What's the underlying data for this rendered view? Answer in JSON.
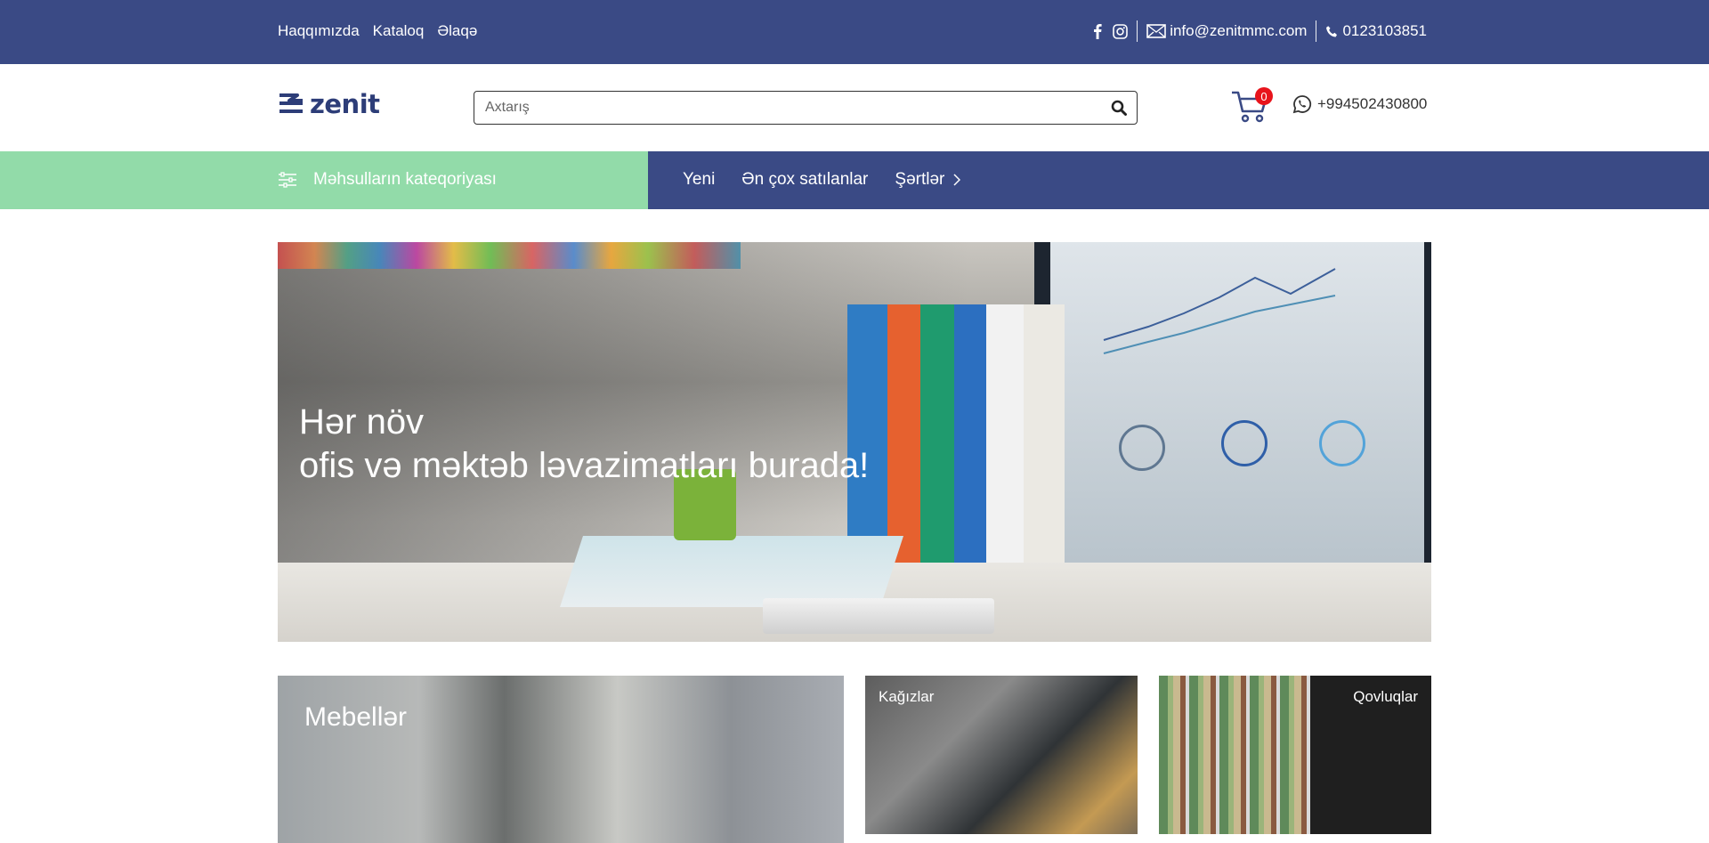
{
  "topbar": {
    "nav": [
      "Haqqımızda",
      "Kataloq",
      "Əlaqə"
    ],
    "email": "info@zenitmmc.com",
    "phone": "0123103851"
  },
  "header": {
    "logo_text": "zenit",
    "search_placeholder": "Axtarış",
    "cart_count": "0",
    "whatsapp_phone": "+994502430800"
  },
  "catbar": {
    "categories_label": "Məhsulların kateqoriyası",
    "menu": [
      "Yeni",
      "Ən çox satılanlar",
      "Şərtlər"
    ]
  },
  "hero": {
    "line1": "Hər növ",
    "line2": "ofis və məktəb ləvazimatları burada!"
  },
  "tiles": {
    "furniture": "Mebellər",
    "papers": "Kağızlar",
    "folders": "Qovluqlar"
  },
  "colors": {
    "primary": "#3a4a85",
    "accent_green": "#92dba9",
    "badge": "#e8141c"
  }
}
